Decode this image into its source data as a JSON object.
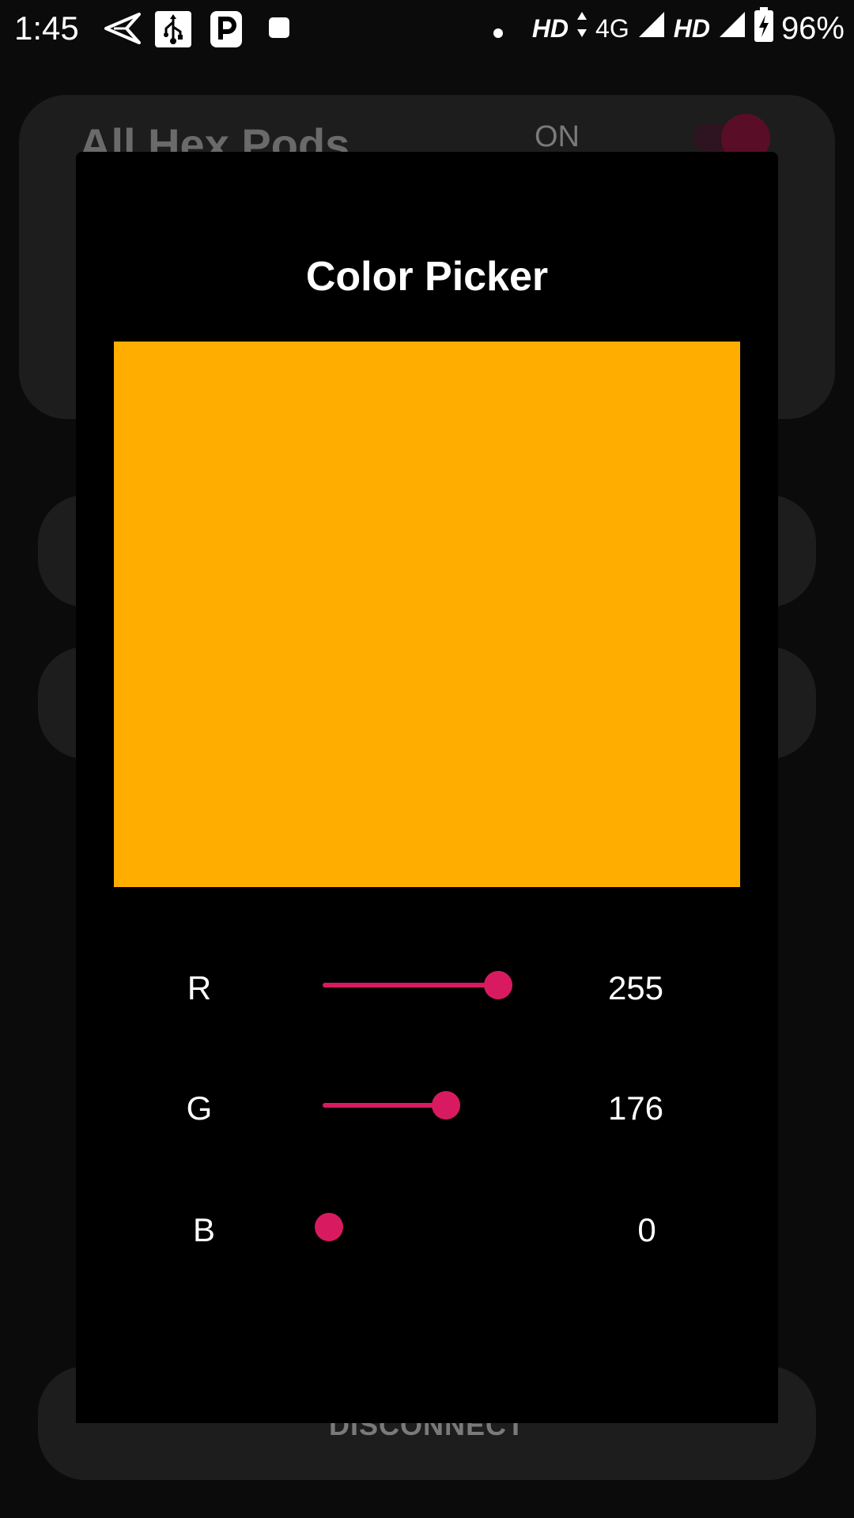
{
  "status_bar": {
    "time": "1:45",
    "battery": "96%",
    "network_1": "HD",
    "network_type": "4G",
    "network_2": "HD",
    "icons": [
      "send-icon",
      "usb-icon",
      "parking-icon",
      "stop-icon",
      "dot-icon",
      "signal-icon",
      "battery-charging-icon"
    ]
  },
  "background": {
    "card_title": "All Hex Pods",
    "toggle_label": "ON",
    "toggle_on": true,
    "disconnect_label": "DISCONNECT"
  },
  "dialog": {
    "title": "Color Picker",
    "preview_color": "#FFAE00",
    "channels": [
      {
        "label": "R",
        "value": "255",
        "level": 1.0
      },
      {
        "label": "G",
        "value": "176",
        "level": 0.69
      },
      {
        "label": "B",
        "value": "0",
        "level": 0.0
      }
    ]
  },
  "colors": {
    "accent": "#D81B60",
    "dialog_bg": "#000000",
    "card_bg": "#1D1D1D",
    "screen_bg": "#0B0B0B"
  }
}
